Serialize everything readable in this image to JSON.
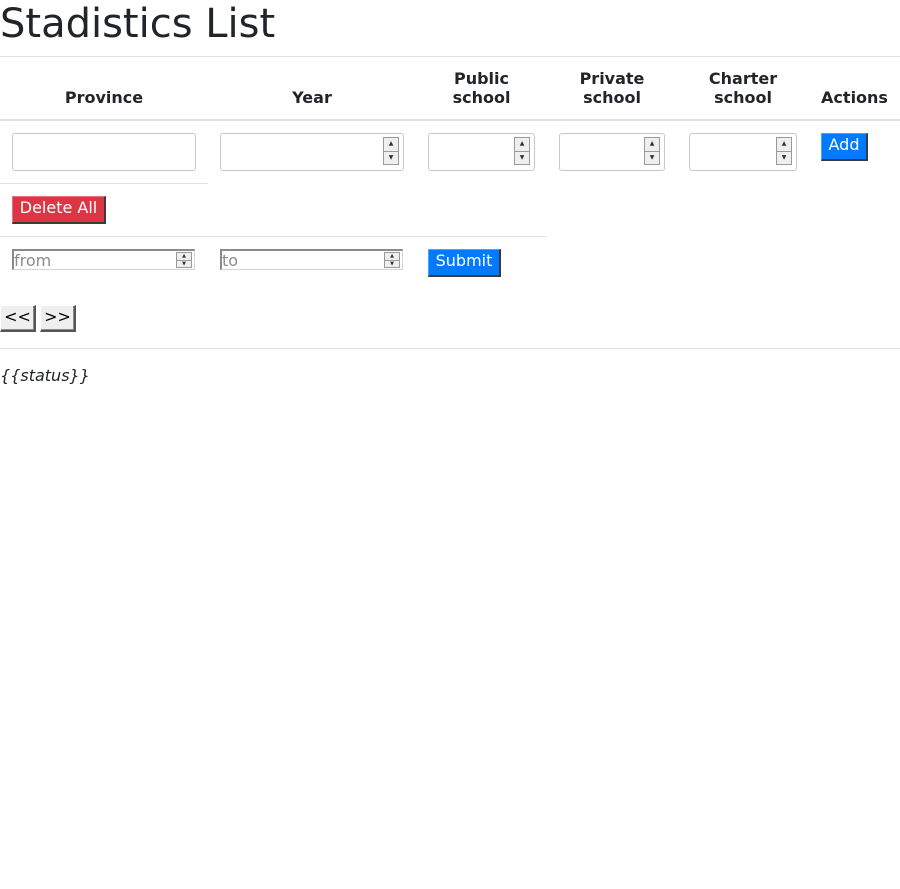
{
  "page": {
    "title": "Stadistics List"
  },
  "table": {
    "headers": {
      "province": "Province",
      "year": "Year",
      "public_line1": "Public",
      "public_line2": "school",
      "private_line1": "Private",
      "private_line2": "school",
      "charter_line1": "Charter",
      "charter_line2": "school",
      "actions": "Actions"
    }
  },
  "buttons": {
    "add": "Add",
    "delete_all": "Delete All",
    "submit": "Submit",
    "prev": "<<",
    "next": ">>"
  },
  "filter": {
    "from_placeholder": "from",
    "to_placeholder": "to"
  },
  "status": "{{status}}",
  "colors": {
    "primary": "#007bff",
    "danger": "#dc3545",
    "border": "#dee2e6",
    "text": "#212529"
  }
}
